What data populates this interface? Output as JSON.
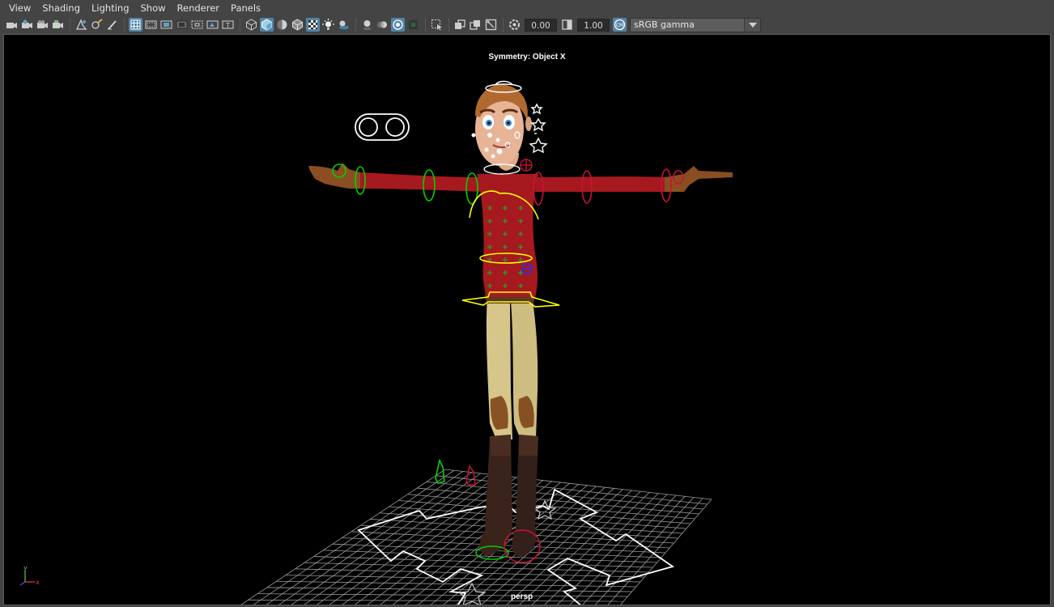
{
  "menu": {
    "items": [
      {
        "label": "View"
      },
      {
        "label": "Shading"
      },
      {
        "label": "Lighting"
      },
      {
        "label": "Show"
      },
      {
        "label": "Renderer"
      },
      {
        "label": "Panels"
      }
    ]
  },
  "toolbar": {
    "exposure_value": "0.00",
    "gamma_value": "1.00",
    "color_space": "sRGB gamma"
  },
  "viewport": {
    "symmetry_label": "Symmetry: Object X",
    "camera_label": "persp",
    "axis_x": "x",
    "axis_y": "y"
  },
  "colors": {
    "background": "#000000",
    "panel": "#444444",
    "active_button": "#5285a6",
    "controller_green": "#00ff00",
    "controller_yellow": "#ffff00",
    "controller_red": "#cc0022",
    "sweater": "#a6191f",
    "pants": "#d8c88a",
    "boots": "#3a231a"
  }
}
